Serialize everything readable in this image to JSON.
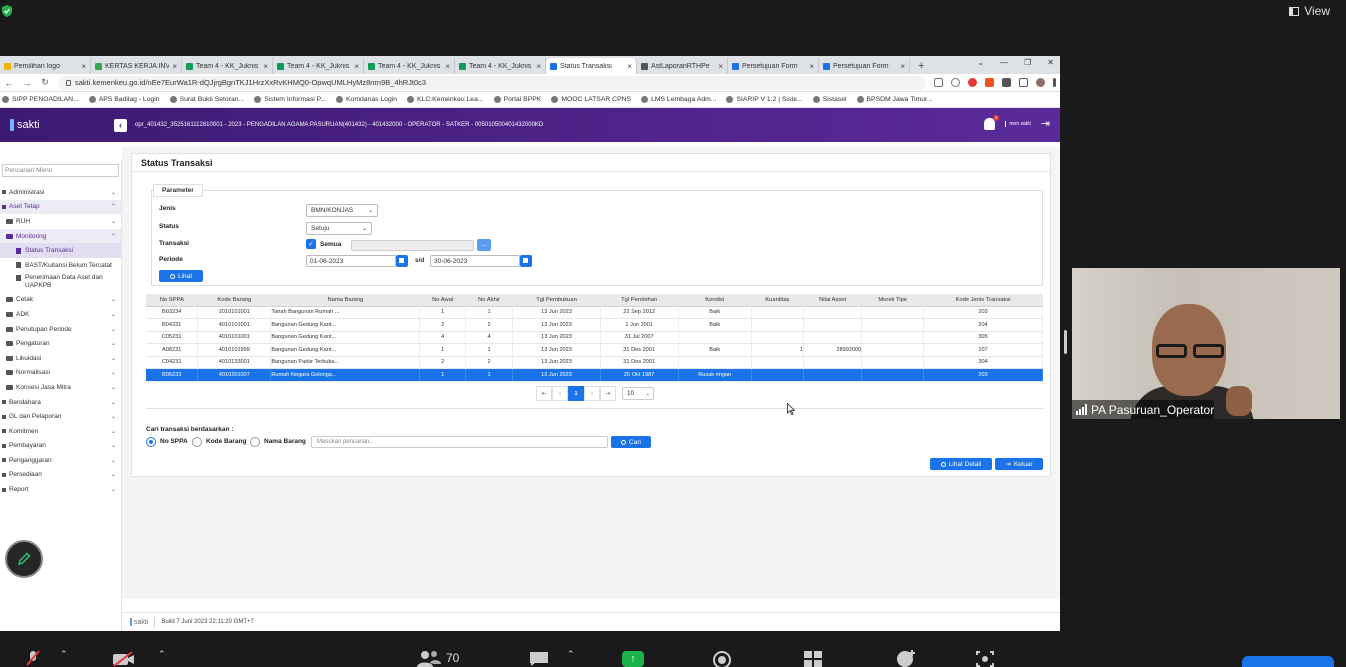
{
  "zoom": {
    "view_label": "View",
    "participant_count": "70",
    "participant_name": "PA Pasuruan_Operator"
  },
  "browser": {
    "tabs": [
      {
        "title": "Pemilihan logo",
        "color": "#f4b400"
      },
      {
        "title": "KERTAS KERJA INV",
        "color": "#34a853"
      },
      {
        "title": "Team 4 - KK_Juknis",
        "color": "#0f9d58"
      },
      {
        "title": "Team 4 - KK_Juknis",
        "color": "#0f9d58"
      },
      {
        "title": "Team 4 - KK_Juknis",
        "color": "#0f9d58"
      },
      {
        "title": "Team 4 - KK_Juknis",
        "color": "#0f9d58"
      },
      {
        "title": "Status Transaksi",
        "color": "#1a73e8"
      },
      {
        "title": "AstLaporanRTHPe",
        "color": "#555555"
      },
      {
        "title": "Persetujuan Form",
        "color": "#1a73e8"
      },
      {
        "title": "Persetujuan Form",
        "color": "#1a73e8"
      }
    ],
    "url": "sakti.kemenkeu.go.id/nEe7EurWa1R-dQJjrgBgnTKJ1HrzXxRvKHMQ0-OpwqUMLHyMz8nrn9B_4hRJt0c3",
    "bookmarks": [
      "SIPP PENGADILAN...",
      "APS Badilag - Login",
      "Surat Bukti Setoran...",
      "Sistem Informasi P...",
      "Komdanas Login",
      "KLC:Kemenkeu Lea...",
      "Portal BPPK",
      "MOOC LATSAR CPNS",
      "LMS Lembaga Adm...",
      "SIARIP V 1.2 | Siste...",
      "Sistasel",
      "BPSDM Jawa Timur..."
    ]
  },
  "app": {
    "logo": "sakti",
    "header_info": "opr_401432_352516111281000​1 - 2023 - PENGADILAN AGAMA PASURUAN(401432) - 401432000 - OPERATOR - SATKER - 005010500401432000KD",
    "notif_count": "2",
    "mon_label": "mon sakti",
    "search_placeholder": "Pencarian Menu",
    "menu": {
      "administrasi": "Administrasi",
      "aset_tetap": "Aset Tetap",
      "ruh": "RUH",
      "monitoring": "Monitoring",
      "status_transaksi": "Status Transaksi",
      "bast": "BAST/Kuitansi Belum Tercatat",
      "penerimaan": "Penerimaan Data Aset dari UAPKPB",
      "cetak": "Cetak",
      "adk": "ADK",
      "penutupan": "Penutupan Periode",
      "pengaturan": "Pengaturan",
      "likuidasi": "Likuidasi",
      "normalisasi": "Normalisasi",
      "konsesi": "Konsesi Jasa Mitra",
      "bendahara": "Bendahara",
      "gl": "GL dan Pelaporan",
      "komitmen": "Komitmen",
      "pembayaran": "Pembayaran",
      "penganggaran": "Penganggaran",
      "persediaan": "Persediaan",
      "report": "Report"
    },
    "footer_logo": "sakti",
    "footer_build": "Build 7 Juni 2023 22:11:20 GMT+7"
  },
  "page": {
    "title": "Status Transaksi",
    "parameter_legend": "Parameter",
    "labels": {
      "jenis": "Jenis",
      "status": "Status",
      "transaksi": "Transaksi",
      "periode": "Periode",
      "semua": "Semua",
      "sd": "s/d"
    },
    "jenis_value": "BMN/KONJAS",
    "status_value": "Setuju",
    "dots_label": "...",
    "periode_from": "01-06-2023",
    "periode_to": "30-06-2023",
    "lihat_label": "Lihat",
    "table": {
      "headers": [
        "No SPPA",
        "Kode Barang",
        "Nama Barang",
        "No Awal",
        "No Akhir",
        "Tgl Pembukuan",
        "Tgl Perolehan",
        "Kondisi",
        "Kuantitas",
        "Nilai Asset",
        "Merek Tipe",
        "Kode Jenis Transaksi"
      ],
      "rows": [
        [
          "B03234",
          "2010101001",
          "Tanah Bangunan Rumah ...",
          "1",
          "1",
          "13 Jun 2023",
          "22 Sep 2012",
          "Baik",
          "",
          "",
          "",
          "203"
        ],
        [
          "B04231",
          "4010101001",
          "Bangunan Gedung Kant...",
          "2",
          "2",
          "13 Jun 2023",
          "1 Jun 2001",
          "Baik",
          "",
          "",
          "",
          "204"
        ],
        [
          "C05231",
          "4010101001",
          "Bangunan Gedung Kant...",
          "4",
          "4",
          "13 Jun 2023",
          "31 Jul 2007",
          "",
          "",
          "",
          "",
          "305"
        ],
        [
          "A08231",
          "4010101999",
          "Bangunan Gedung Kant...",
          "1",
          "1",
          "13 Jun 2023",
          "31 Des 2001",
          "Baik",
          "1",
          "28992000",
          "",
          "107"
        ],
        [
          "C04231",
          "4010133001",
          "Bangunan Parkir Terbuka...",
          "2",
          "2",
          "13 Jun 2023",
          "31 Des 2001",
          "",
          "",
          "",
          "",
          "304"
        ],
        [
          "B05233",
          "4010201007",
          "Rumah Negara Golonga...",
          "1",
          "1",
          "13 Jun 2023",
          "20 Okt 1987",
          "Rusak ringan",
          "",
          "",
          "",
          "203"
        ]
      ],
      "selected_row": 5
    },
    "pager": {
      "current": "1",
      "page_size": "10"
    },
    "search": {
      "label": "Cari transaksi berdasarkan :",
      "options": [
        "No SPPA",
        "Kode Barang",
        "Nama Barang"
      ],
      "selected": "No SPPA",
      "placeholder": "Masukan pencarian..",
      "button": "Cari"
    },
    "actions": {
      "detail": "Lihat Detail",
      "keluar": "Keluar"
    }
  }
}
